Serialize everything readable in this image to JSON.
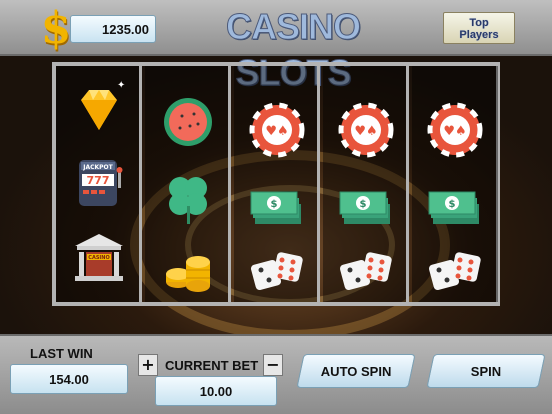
{
  "header": {
    "currency_icon": "$",
    "balance": "1235.00",
    "title": "CASINO SLOTS",
    "top_players_line1": "Top",
    "top_players_line2": "Players"
  },
  "reels": [
    [
      "diamond-icon",
      "jackpot-slot-machine-icon",
      "casino-building-icon"
    ],
    [
      "watermelon-icon",
      "clover-icon",
      "coins-icon"
    ],
    [
      "poker-chip-icon",
      "cash-stack-icon",
      "dice-icon"
    ],
    [
      "poker-chip-icon",
      "cash-stack-icon",
      "dice-icon"
    ],
    [
      "poker-chip-icon",
      "cash-stack-icon",
      "dice-icon"
    ]
  ],
  "symbol_text": {
    "jackpot": "JACKPOT",
    "sevens": "777",
    "casino": "CASINO"
  },
  "controls": {
    "last_win_label": "LAST WIN",
    "last_win_value": "154.00",
    "plus": "+",
    "minus": "−",
    "current_bet_label": "CURRENT BET",
    "current_bet_value": "10.00",
    "auto_spin": "AUTO SPIN",
    "spin": "SPIN"
  },
  "colors": {
    "coin": "#f2b400",
    "chip": "#e8553c",
    "cash": "#3aa37a",
    "clover": "#3fb886",
    "title": "#9fb9dc"
  }
}
